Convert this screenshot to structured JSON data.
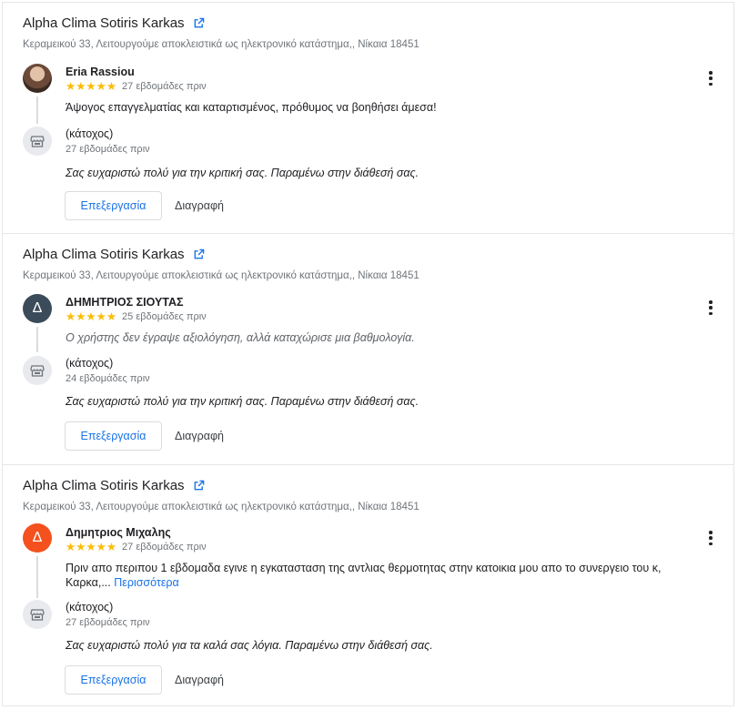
{
  "cards": [
    {
      "business_name": "Alpha Clima Sotiris Karkas",
      "address": "Κεραμεικού 33, Λειτουργούμε αποκλειστικά ως ηλεκτρονικό κατάστημα,, Νίκαια 18451",
      "reviewer": {
        "name": "Eria Rassiou",
        "avatar": "photo",
        "avatar_letter": ""
      },
      "rating": 5,
      "stars": "★★★★★",
      "review_time": "27 εβδομάδες πριν",
      "review_text": "Άψογος επαγγελματίας και καταρτισμένος, πρόθυμος να βοηθήσει άμεσα!",
      "review_more": "",
      "owner_label": "(κάτοχος)",
      "owner_time": "27 εβδομάδες πριν",
      "reply_text": "Σας ευχαριστώ πολύ για την κριτική σας. Παραμένω στην διάθεσή σας.",
      "edit_label": "Επεξεργασία",
      "delete_label": "Διαγραφή"
    },
    {
      "business_name": "Alpha Clima Sotiris Karkas",
      "address": "Κεραμεικού 33, Λειτουργούμε αποκλειστικά ως ηλεκτρονικό κατάστημα,, Νίκαια 18451",
      "reviewer": {
        "name": "ΔΗΜΗΤΡΙΟΣ ΣΙΟΥΤΑΣ",
        "avatar": "letter-dark",
        "avatar_letter": "Δ"
      },
      "rating": 5,
      "stars": "★★★★★",
      "review_time": "25 εβδομάδες πριν",
      "review_text": "Ο χρήστης δεν έγραψε αξιολόγηση, αλλά καταχώρισε μια βαθμολογία.",
      "review_more": "",
      "owner_label": "(κάτοχος)",
      "owner_time": "24 εβδομάδες πριν",
      "reply_text": "Σας ευχαριστώ πολύ για την κριτική σας. Παραμένω στην διάθεσή σας.",
      "edit_label": "Επεξεργασία",
      "delete_label": "Διαγραφή"
    },
    {
      "business_name": "Alpha Clima Sotiris Karkas",
      "address": "Κεραμεικού 33, Λειτουργούμε αποκλειστικά ως ηλεκτρονικό κατάστημα,, Νίκαια 18451",
      "reviewer": {
        "name": "Δημητριος Μιχαλης",
        "avatar": "letter-orange",
        "avatar_letter": "Δ"
      },
      "rating": 5,
      "stars": "★★★★★",
      "review_time": "27 εβδομάδες πριν",
      "review_text": "Πριν απο περιπου 1 εβδομαδα εγινε η εγκατασταση της αντλιας θερμοτητας στην κατοικια μου απο το συνεργειο του κ, Καρκα,...",
      "review_more": "Περισσότερα",
      "owner_label": "(κάτοχος)",
      "owner_time": "27 εβδομάδες πριν",
      "reply_text": "Σας ευχαριστώ πολύ για τα καλά σας λόγια. Παραμένω στην διάθεσή σας.",
      "edit_label": "Επεξεργασία",
      "delete_label": "Διαγραφή"
    }
  ],
  "colors": {
    "accent": "#1a73e8",
    "star": "#fbbc04",
    "avatar_dark": "#3c4b59",
    "avatar_orange": "#f4511e",
    "muted_text": "#70757a"
  },
  "icons": {
    "external_link": "external-link-icon",
    "menu": "more-vert-icon",
    "owner": "storefront-icon"
  }
}
